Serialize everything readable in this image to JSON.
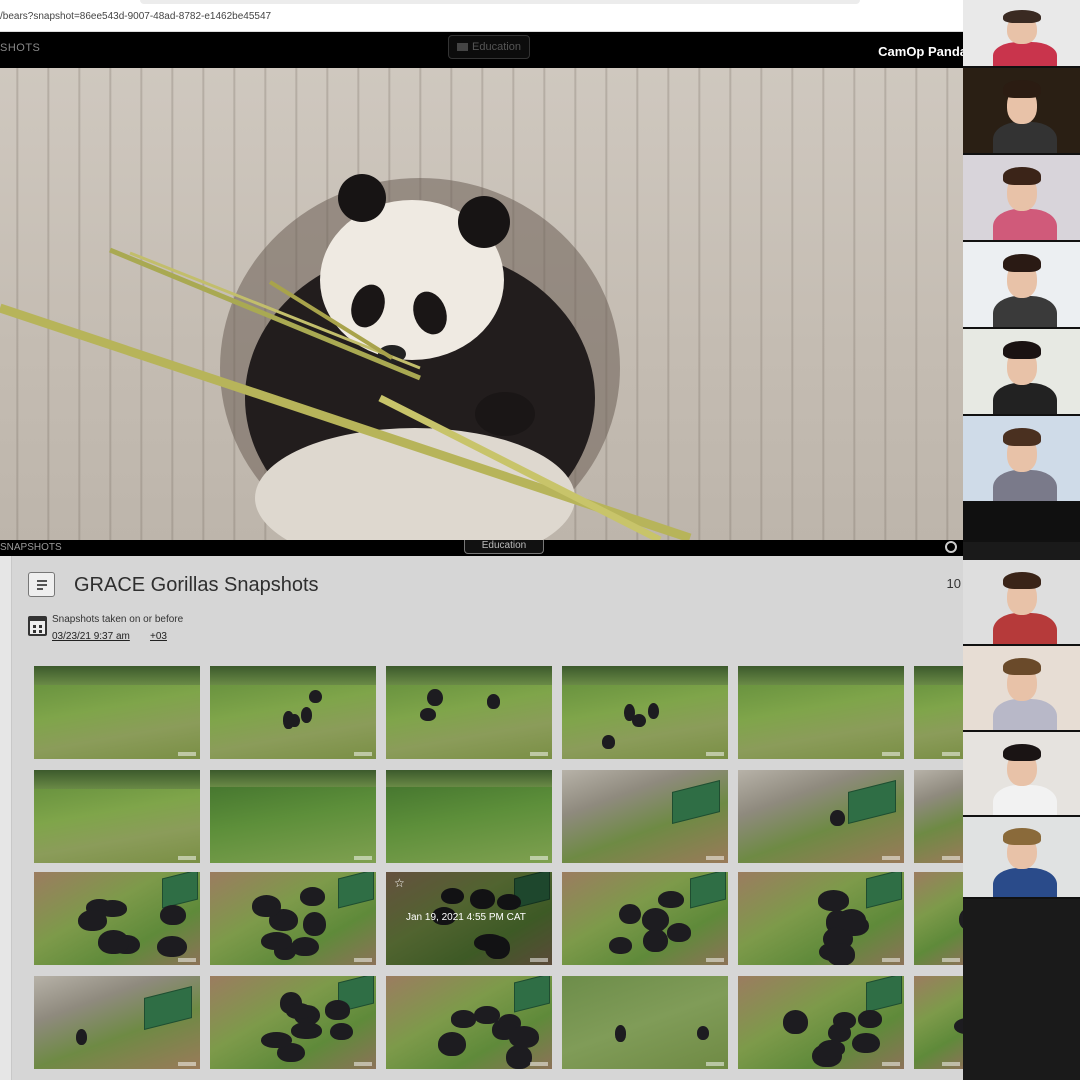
{
  "browser": {
    "url": "/bears?snapshot=86ee543d-9007-48ad-8782-e1462be45547"
  },
  "cam_header": {
    "section_label": "SHOTS",
    "education_button": "Education",
    "title": "CamOp Panda"
  },
  "snapshots_header": {
    "section_label": "SNAPSHOTS",
    "education_button": "Education",
    "search_icon": "search-icon"
  },
  "panel": {
    "title": "GRACE Gorillas Snapshots",
    "count": "10",
    "menu_icon": "list-menu-icon",
    "calendar_icon": "calendar-icon",
    "taken_label": "Snapshots taken on or before",
    "taken_date": "03/23/21 9:37 am",
    "timezone": "+03"
  },
  "thumbnails": [
    {
      "scene": "hill",
      "gorillas": 0
    },
    {
      "scene": "hill",
      "gorillas": 4
    },
    {
      "scene": "hill",
      "gorillas": 3
    },
    {
      "scene": "hill",
      "gorillas": 4
    },
    {
      "scene": "hill",
      "gorillas": 0
    },
    {
      "scene": "hill-edge",
      "gorillas": 1
    },
    {
      "scene": "hill",
      "gorillas": 0
    },
    {
      "scene": "bush",
      "gorillas": 0
    },
    {
      "scene": "bush",
      "gorillas": 0
    },
    {
      "scene": "bin",
      "gorillas": 0
    },
    {
      "scene": "bin",
      "gorillas": 1
    },
    {
      "scene": "bin-edge",
      "gorillas": 0
    },
    {
      "scene": "group",
      "gorillas": 7
    },
    {
      "scene": "group",
      "gorillas": 7
    },
    {
      "scene": "group-selected",
      "gorillas": 6,
      "timestamp": "Jan 19, 2021 4:55 PM CAT",
      "star_icon": "star-icon"
    },
    {
      "scene": "group",
      "gorillas": 7
    },
    {
      "scene": "group",
      "gorillas": 7
    },
    {
      "scene": "group-edge",
      "gorillas": 5
    },
    {
      "scene": "bin",
      "gorillas": 1
    },
    {
      "scene": "group",
      "gorillas": 8
    },
    {
      "scene": "group",
      "gorillas": 7
    },
    {
      "scene": "field",
      "gorillas": 2
    },
    {
      "scene": "group",
      "gorillas": 7
    },
    {
      "scene": "group-edge",
      "gorillas": 6
    }
  ],
  "participants": [
    {
      "name": "participant-1",
      "bg": "#e9e9e9"
    },
    {
      "name": "participant-2",
      "bg": "#2a1f14"
    },
    {
      "name": "participant-3",
      "bg": "#d8d4da"
    },
    {
      "name": "participant-4",
      "bg": "#eceff2"
    },
    {
      "name": "participant-5",
      "bg": "#e7e9e3"
    },
    {
      "name": "participant-6",
      "bg": "#cfdbe8"
    },
    {
      "name": "participant-7",
      "bg": "#101010"
    },
    {
      "name": "participant-8",
      "bg": "#dedede"
    },
    {
      "name": "participant-9",
      "bg": "#e7ddd4"
    },
    {
      "name": "participant-10",
      "bg": "#e6e3df"
    },
    {
      "name": "participant-11",
      "bg": "#e0e2e2"
    }
  ]
}
